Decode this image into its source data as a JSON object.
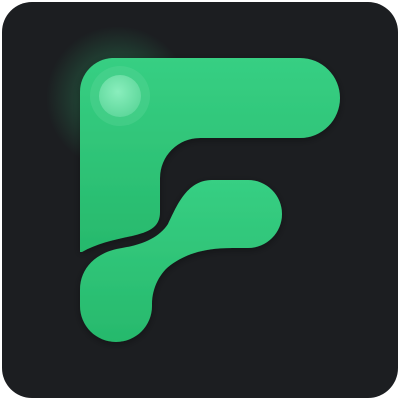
{
  "icon": {
    "name": "F",
    "semantic": "letter-f-logo-icon"
  },
  "colors": {
    "page_background": "#ffffff",
    "tile_background": "#1c1e21",
    "brand_green": "#2fc67a",
    "brand_green_light": "#3fd98a",
    "brand_green_dark": "#23a864",
    "dot_fill": "#79e4ad",
    "glow": "#33d17f"
  }
}
